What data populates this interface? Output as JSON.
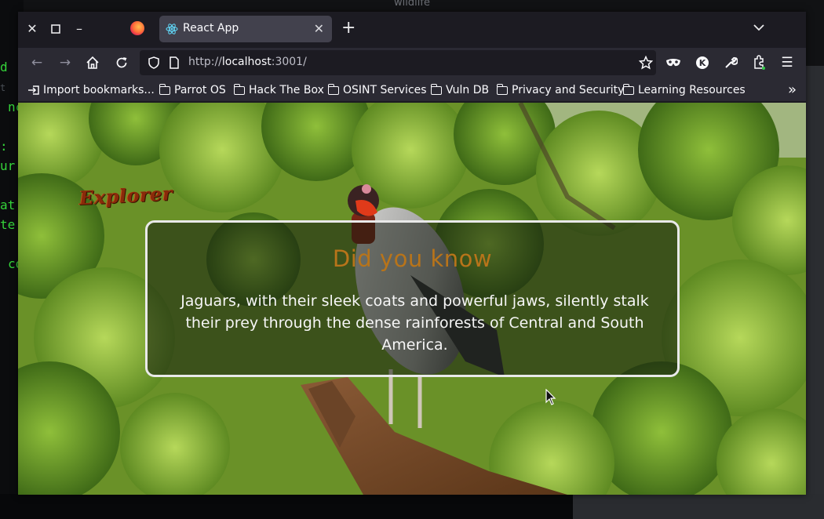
{
  "desktop": {
    "window_title": "wildlife",
    "terminal_lines": [
      "d",
      "nc",
      ":",
      "ur",
      "at",
      "te",
      "co"
    ]
  },
  "browser": {
    "tab": {
      "title": "React App"
    },
    "url": {
      "protocol": "http://",
      "host": "localhost",
      "port": ":3001/"
    },
    "bookmarks": [
      {
        "label": "Import bookmarks...",
        "icon": "import-icon"
      },
      {
        "label": "Parrot OS",
        "icon": "folder-icon"
      },
      {
        "label": "Hack The Box",
        "icon": "folder-icon"
      },
      {
        "label": "OSINT Services",
        "icon": "folder-icon"
      },
      {
        "label": "Vuln DB",
        "icon": "folder-icon"
      },
      {
        "label": "Privacy and Security",
        "icon": "folder-icon"
      },
      {
        "label": "Learning Resources",
        "icon": "folder-icon"
      }
    ]
  },
  "page": {
    "logo": "Explorer",
    "fact_card": {
      "title": "Did you know",
      "text": "Jaguars, with their sleek coats and powerful jaws, silently stalk their prey through the dense rainforests of Central and South America."
    }
  },
  "colors": {
    "title_accent": "#b8741a",
    "card_border": "#e9e9e9",
    "logo": "#8a2a0a"
  }
}
